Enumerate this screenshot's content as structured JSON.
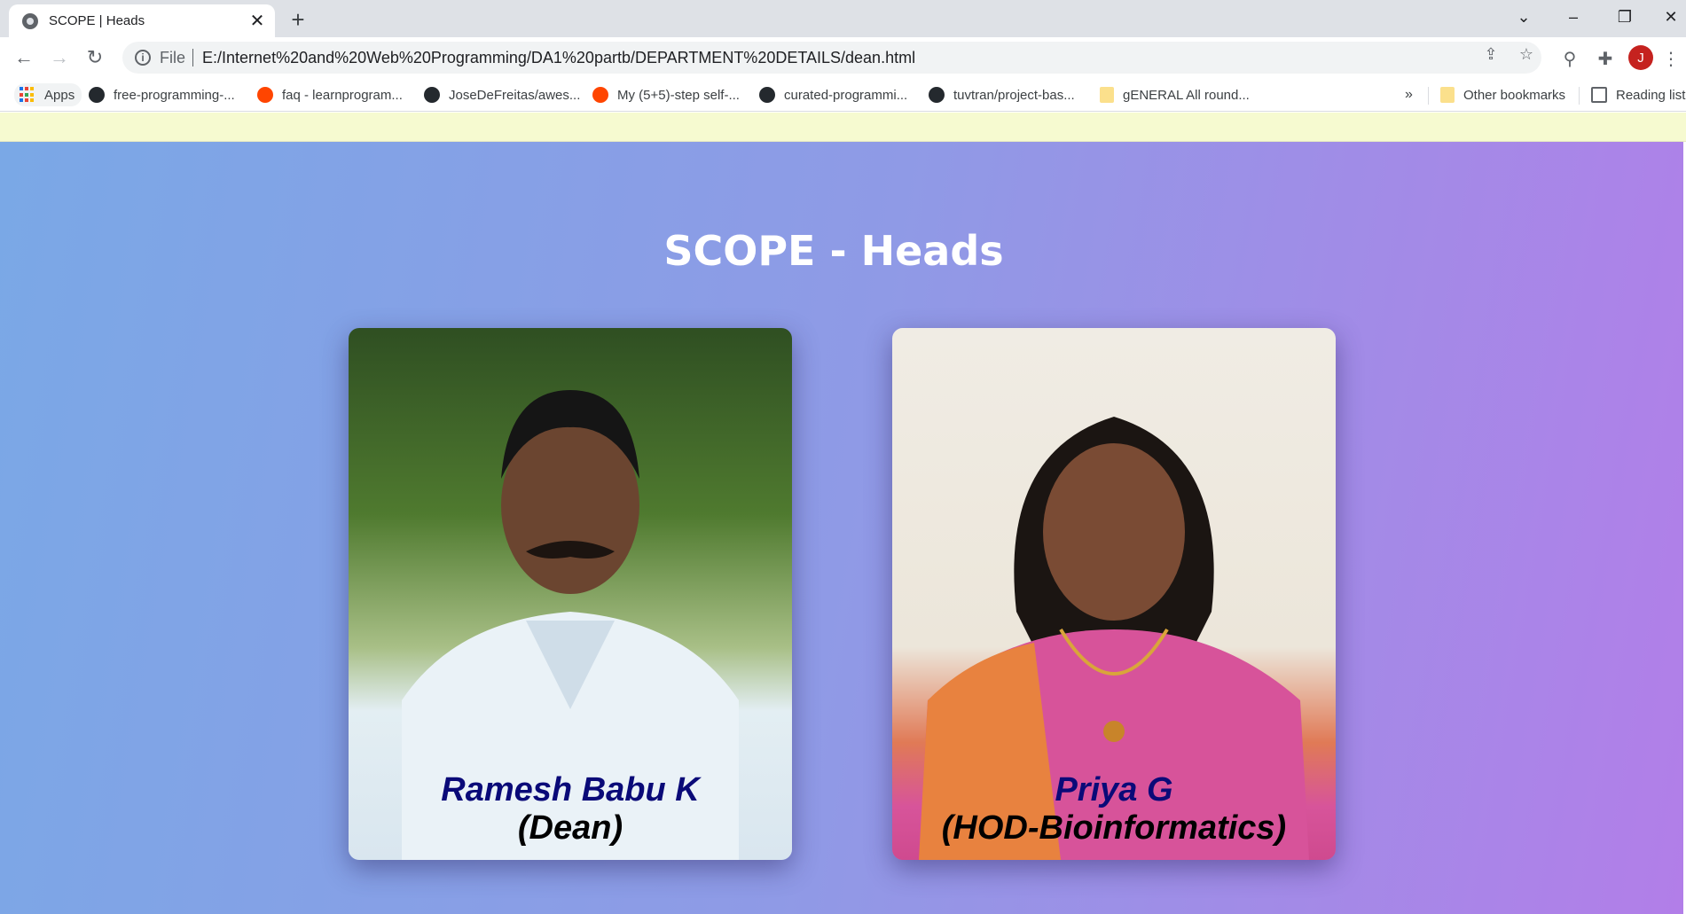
{
  "browser": {
    "tab_title": "SCOPE | Heads",
    "address_scheme": "File",
    "address_url": "E:/Internet%20and%20Web%20Programming/DA1%20partb/DEPARTMENT%20DETAILS/dean.html",
    "profile_initial": "J",
    "profile_color": "#c5221f"
  },
  "bookmarks": {
    "apps_label": "Apps",
    "items": [
      {
        "label": "free-programming-...",
        "icon": "github-icon"
      },
      {
        "label": "faq - learnprogram...",
        "icon": "reddit-icon"
      },
      {
        "label": "JoseDeFreitas/awes...",
        "icon": "github-icon"
      },
      {
        "label": "My (5+5)-step self-...",
        "icon": "reddit-icon"
      },
      {
        "label": "curated-programmi...",
        "icon": "github-icon"
      },
      {
        "label": "tuvtran/project-bas...",
        "icon": "github-icon"
      },
      {
        "label": "gENERAL All round...",
        "icon": "folder-icon"
      }
    ],
    "overflow": "»",
    "other_bookmarks": "Other bookmarks",
    "reading_list": "Reading list"
  },
  "page": {
    "heading": "SCOPE - Heads",
    "gradient_start": "#7aa8e6",
    "gradient_end": "#b27ee8",
    "cards": [
      {
        "name": "Ramesh Babu K",
        "role": "(Dean)"
      },
      {
        "name": "Priya G",
        "role": "(HOD-Bioinformatics)"
      }
    ]
  }
}
